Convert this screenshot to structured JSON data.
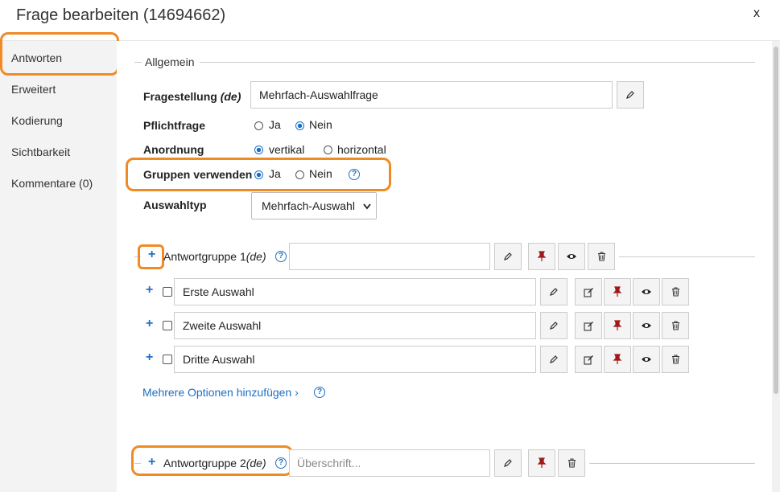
{
  "dialog": {
    "title": "Frage bearbeiten (14694662)",
    "close": "x"
  },
  "sidebar": {
    "items": [
      {
        "label": "Antworten"
      },
      {
        "label": "Erweitert"
      },
      {
        "label": "Kodierung"
      },
      {
        "label": "Sichtbarkeit"
      },
      {
        "label": "Kommentare (0)"
      }
    ]
  },
  "form": {
    "legend": "Allgemein",
    "question_label": "Fragestellung",
    "question_lang": "(de)",
    "question_value": "Mehrfach-Auswahlfrage",
    "required_label": "Pflichtfrage",
    "required_options": [
      "Ja",
      "Nein"
    ],
    "order_label": "Anordnung",
    "order_options": [
      "vertikal",
      "horizontal"
    ],
    "groups_label": "Gruppen verwenden",
    "groups_options": [
      "Ja",
      "Nein"
    ],
    "type_label": "Auswahltyp",
    "type_value": "Mehrfach-Auswahl"
  },
  "group1": {
    "label": "Antwortgruppe 1",
    "lang": "(de)",
    "answers": [
      "Erste Auswahl",
      "Zweite Auswahl",
      "Dritte Auswahl"
    ],
    "more_link": "Mehrere Optionen hinzufügen ›"
  },
  "group2": {
    "label": "Antwortgruppe 2",
    "lang": "(de)",
    "placeholder": "Überschrift..."
  },
  "colors": {
    "accent": "#1f6fc2",
    "highlight": "#f08a24",
    "pin": "#a01818"
  },
  "icons": [
    "pencil-icon",
    "edit-icon",
    "pin-icon",
    "eye-icon",
    "trash-icon",
    "plus-icon",
    "help-icon"
  ]
}
